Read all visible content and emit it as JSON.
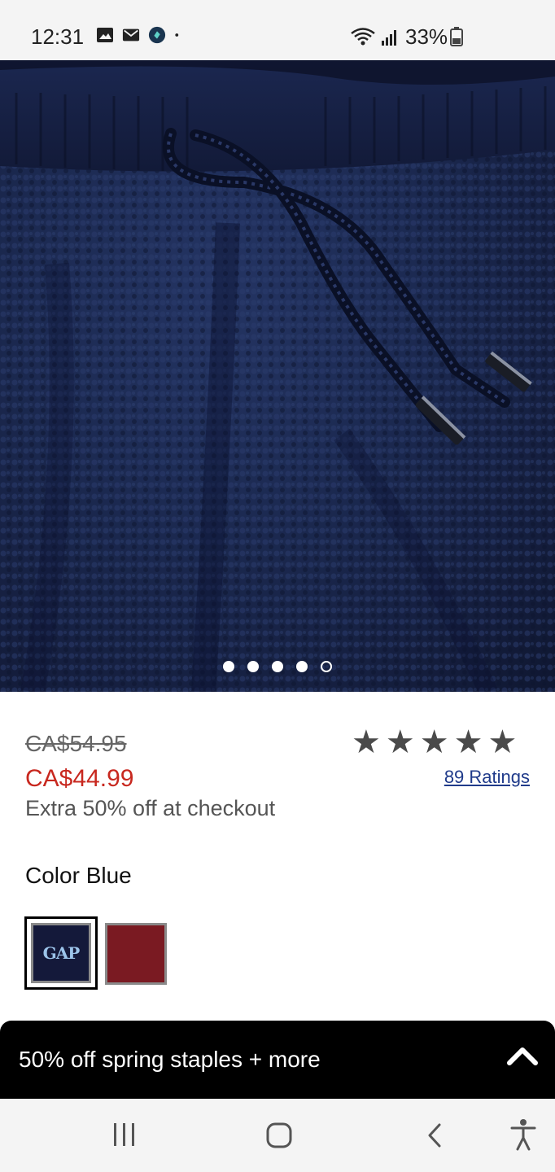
{
  "status_bar": {
    "time": "12:31",
    "battery": "33%",
    "icons": [
      "gallery-icon",
      "mail-icon",
      "app-icon",
      "dot-icon",
      "wifi-icon",
      "signal-icon",
      "battery-icon"
    ]
  },
  "carousel": {
    "page_count": 5,
    "active_index": 4
  },
  "product": {
    "original_price": "CA$54.95",
    "sale_price": "CA$44.99",
    "promo": "Extra 50% off at checkout",
    "rating_stars": 5,
    "ratings_link": "89 Ratings",
    "color_label": "Color Blue",
    "swatches": [
      {
        "name": "Blue",
        "selected": true,
        "color": "#14193a",
        "logo": "GAP"
      },
      {
        "name": "Red",
        "selected": false,
        "color": "#7a1a22"
      }
    ]
  },
  "banner": {
    "text": "50% off spring staples + more"
  },
  "colors": {
    "sale_red": "#c8281f",
    "link_blue": "#1f3a8a",
    "navy": "#1c2a52"
  },
  "nav": {
    "buttons": [
      "recent-apps",
      "home",
      "back",
      "accessibility"
    ]
  }
}
